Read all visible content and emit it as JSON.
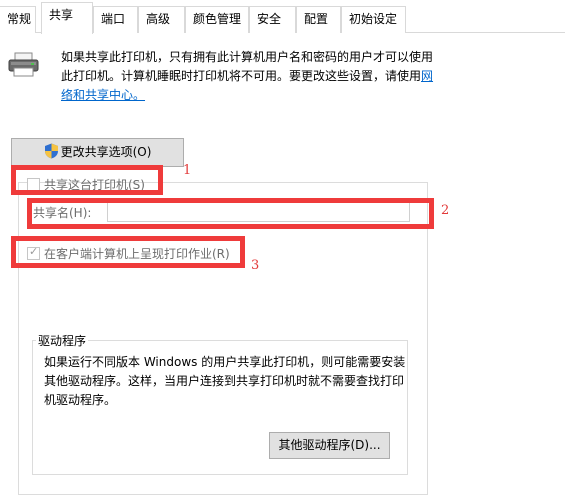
{
  "tabs": [
    "常规",
    "共享",
    "端口",
    "高级",
    "颜色管理",
    "安全",
    "配置",
    "初始设定"
  ],
  "active_tab": "共享",
  "intro": {
    "text": "如果共享此打印机，只有拥有此计算机用户名和密码的用户才可以使用此打印机。计算机睡眠时打印机将不可用。要更改这些设置，请使用",
    "link": "网络和共享中心。"
  },
  "buttons": {
    "change_sharing": "更改共享选项(O)",
    "other_drivers": "其他驱动程序(D)..."
  },
  "share_checkbox": {
    "label": "共享这台打印机(S)",
    "checked": false
  },
  "share_name": {
    "label": "共享名(H):",
    "value": ""
  },
  "render_jobs_checkbox": {
    "label": "在客户端计算机上呈现打印作业(R)",
    "checked": true
  },
  "drivers": {
    "legend": "驱动程序",
    "text": "如果运行不同版本 Windows 的用户共享此打印机，则可能需要安装其他驱动程序。这样，当用户连接到共享打印机时就不需要查找打印机驱动程序。"
  },
  "annotations": [
    "1",
    "2",
    "3"
  ],
  "colors": {
    "highlight": "#ef3b3b",
    "link": "#0066cc"
  }
}
